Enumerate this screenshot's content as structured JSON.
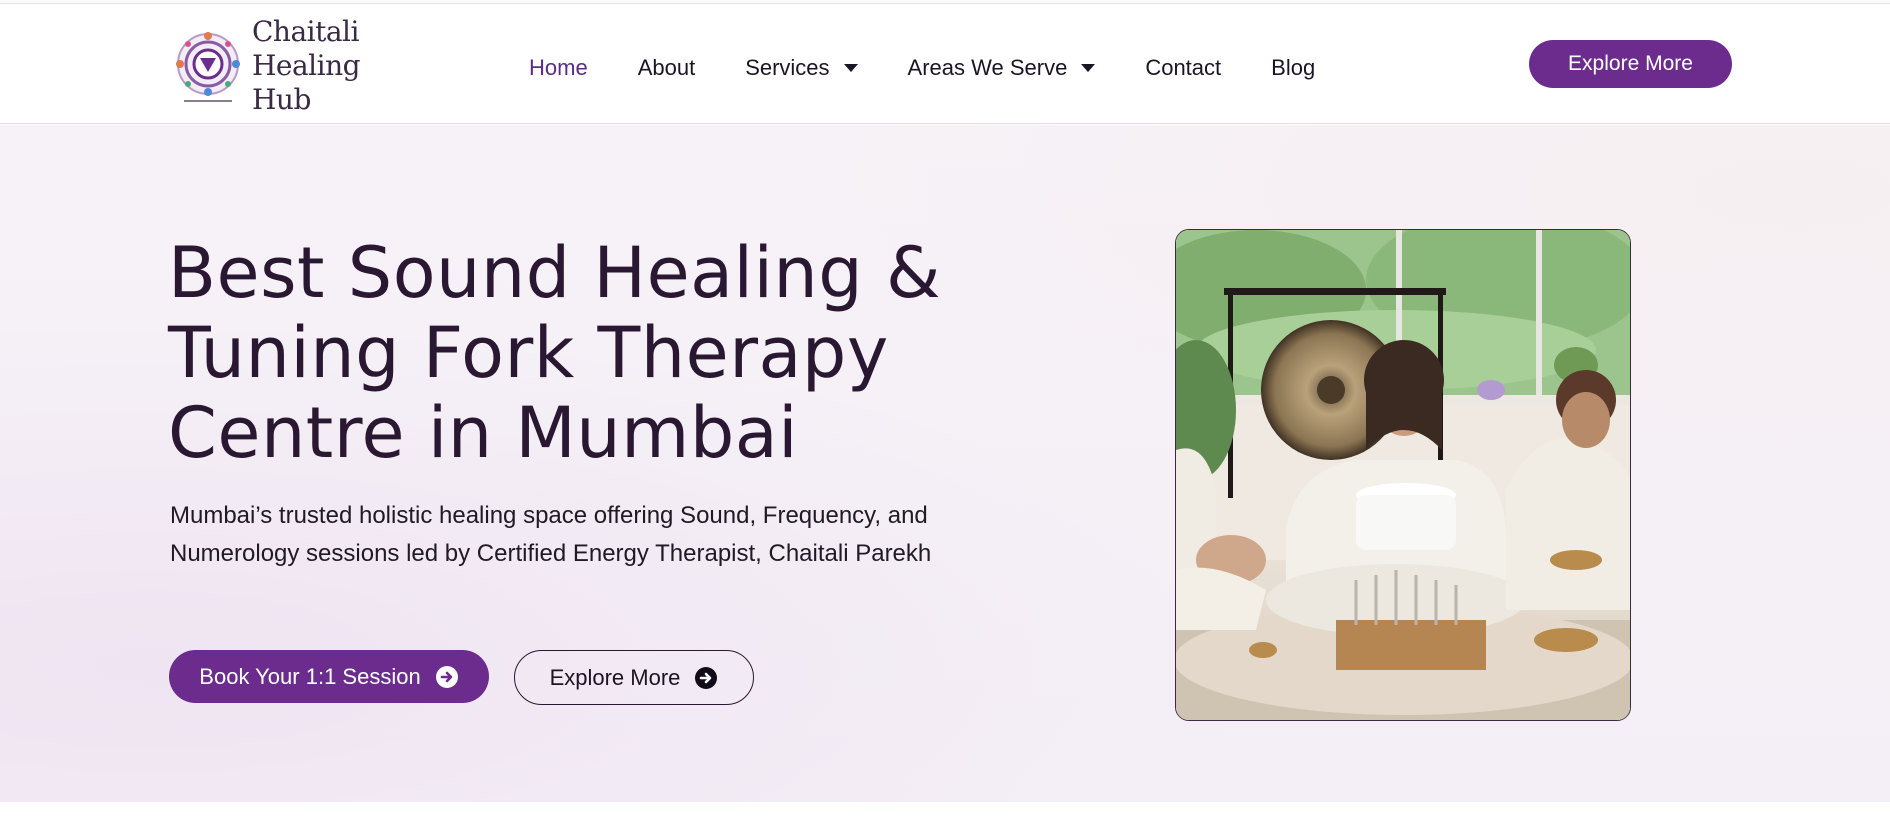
{
  "brand": {
    "name_line1": "Chaitali",
    "name_line2": "Healing Hub"
  },
  "nav": {
    "items": [
      {
        "label": "Home",
        "active": true,
        "has_dropdown": false
      },
      {
        "label": "About",
        "active": false,
        "has_dropdown": false
      },
      {
        "label": "Services",
        "active": false,
        "has_dropdown": true
      },
      {
        "label": "Areas We Serve",
        "active": false,
        "has_dropdown": true
      },
      {
        "label": "Contact",
        "active": false,
        "has_dropdown": false
      },
      {
        "label": "Blog",
        "active": false,
        "has_dropdown": false
      }
    ],
    "cta_label": "Explore More"
  },
  "hero": {
    "title_line1": "Best Sound Healing &",
    "title_line2": "Tuning Fork Therapy",
    "title_line3": "Centre in Mumbai",
    "description": "Mumbai’s trusted holistic healing space offering Sound, Frequency, and Numerology sessions led by Certified Energy Therapist, Chaitali Parekh",
    "primary_button": "Book Your 1:1 Session",
    "secondary_button": "Explore More"
  },
  "icons": {
    "logo": "mandala-logo-icon",
    "dropdown": "caret-down-icon",
    "arrow": "arrow-right-circle-icon"
  },
  "colors": {
    "brand_purple": "#6b2c8e",
    "active_nav": "#5b2d86",
    "heading": "#2a1833"
  }
}
